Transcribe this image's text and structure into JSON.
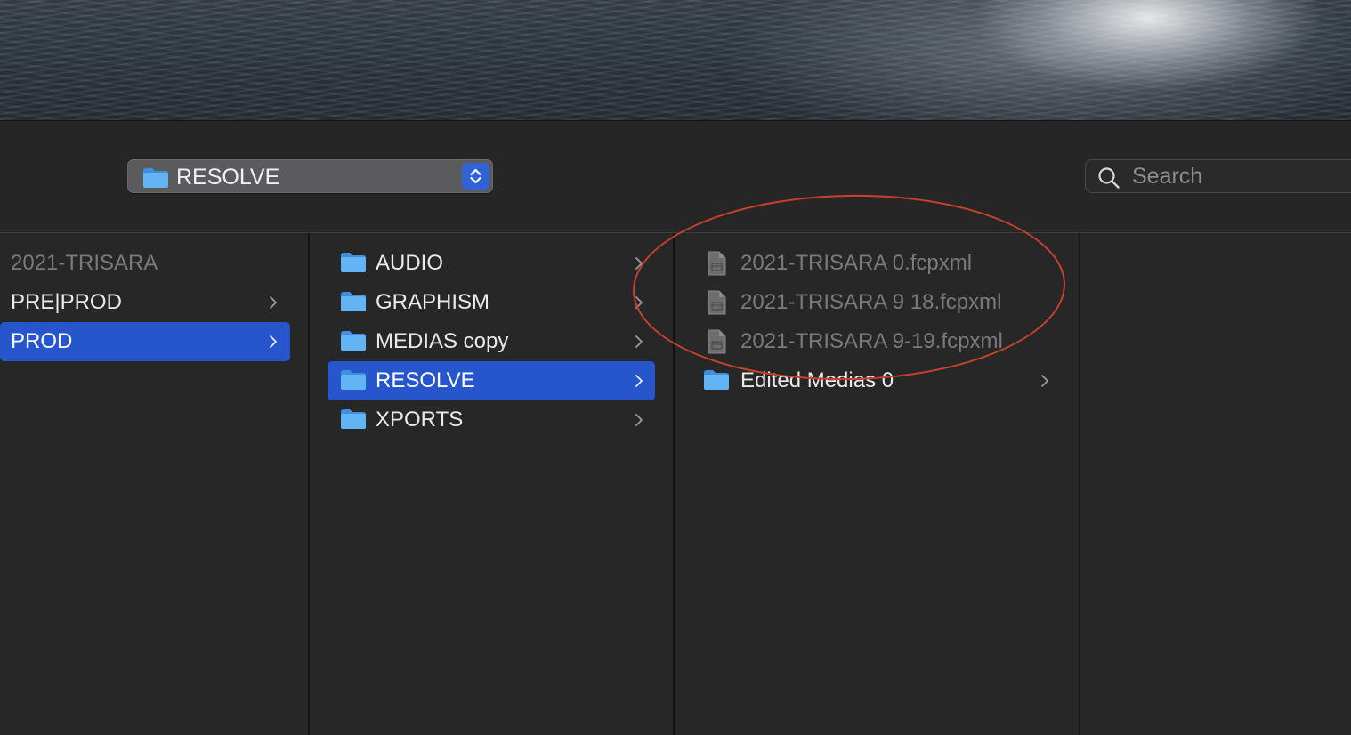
{
  "window": {
    "path_popup": {
      "label": "RESOLVE"
    },
    "search": {
      "placeholder": "Search",
      "value": ""
    }
  },
  "columns": [
    {
      "items": [
        {
          "label": "2021-TRISARA",
          "kind": "header",
          "selected": false
        },
        {
          "label": "PRE|PROD",
          "kind": "folder",
          "selected": false
        },
        {
          "label": "PROD",
          "kind": "folder",
          "selected": true
        }
      ]
    },
    {
      "items": [
        {
          "label": "AUDIO",
          "kind": "folder",
          "selected": false
        },
        {
          "label": "GRAPHISM",
          "kind": "folder",
          "selected": false
        },
        {
          "label": "MEDIAS copy",
          "kind": "folder",
          "selected": false
        },
        {
          "label": "RESOLVE",
          "kind": "folder",
          "selected": true
        },
        {
          "label": "XPORTS",
          "kind": "folder",
          "selected": false
        }
      ]
    },
    {
      "items": [
        {
          "label": "2021-TRISARA 0.fcpxml",
          "kind": "file",
          "disabled": true
        },
        {
          "label": "2021-TRISARA 9 18.fcpxml",
          "kind": "file",
          "disabled": true
        },
        {
          "label": "2021-TRISARA 9-19.fcpxml",
          "kind": "file",
          "disabled": true
        },
        {
          "label": "Edited Medias 0",
          "kind": "folder",
          "disabled": false
        }
      ]
    }
  ],
  "colors": {
    "selection": "#2756cc",
    "folder_blue": "#5aaef2",
    "annotation_red": "#c9402c"
  },
  "icons": [
    "folder-icon",
    "document-icon",
    "chevron-right-icon",
    "search-icon",
    "up-down-stepper-icon"
  ]
}
